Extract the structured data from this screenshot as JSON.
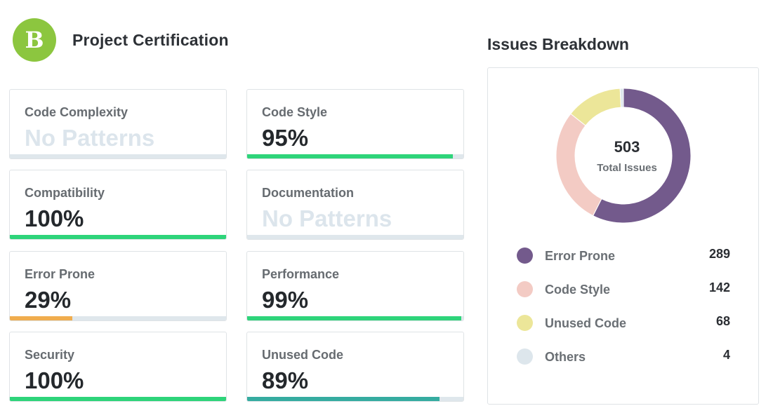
{
  "header": {
    "grade": "B",
    "title": "Project Certification"
  },
  "categories": [
    {
      "label": "Code Complexity",
      "value": "No Patterns",
      "percent": 0,
      "color": "#dfe7ec"
    },
    {
      "label": "Code Style",
      "value": "95%",
      "percent": 95,
      "color": "#2ed47a"
    },
    {
      "label": "Compatibility",
      "value": "100%",
      "percent": 100,
      "color": "#2ed47a"
    },
    {
      "label": "Documentation",
      "value": "No Patterns",
      "percent": 0,
      "color": "#dfe7ec"
    },
    {
      "label": "Error Prone",
      "value": "29%",
      "percent": 29,
      "color": "#f0ad4e"
    },
    {
      "label": "Performance",
      "value": "99%",
      "percent": 99,
      "color": "#2ed47a"
    },
    {
      "label": "Security",
      "value": "100%",
      "percent": 100,
      "color": "#2ed47a"
    },
    {
      "label": "Unused Code",
      "value": "89%",
      "percent": 89,
      "color": "#35aca0"
    }
  ],
  "breakdown": {
    "title": "Issues Breakdown",
    "total": "503",
    "total_label": "Total Issues"
  },
  "chart_data": {
    "type": "pie",
    "variant": "donut",
    "title": "Issues Breakdown",
    "center_text": [
      "503",
      "Total Issues"
    ],
    "categories": [
      "Error Prone",
      "Code Style",
      "Unused Code",
      "Others"
    ],
    "values": [
      289,
      142,
      68,
      4
    ],
    "colors": [
      "#735a8c",
      "#f3cbc4",
      "#ece699",
      "#dde6ec"
    ],
    "legend": "below"
  }
}
